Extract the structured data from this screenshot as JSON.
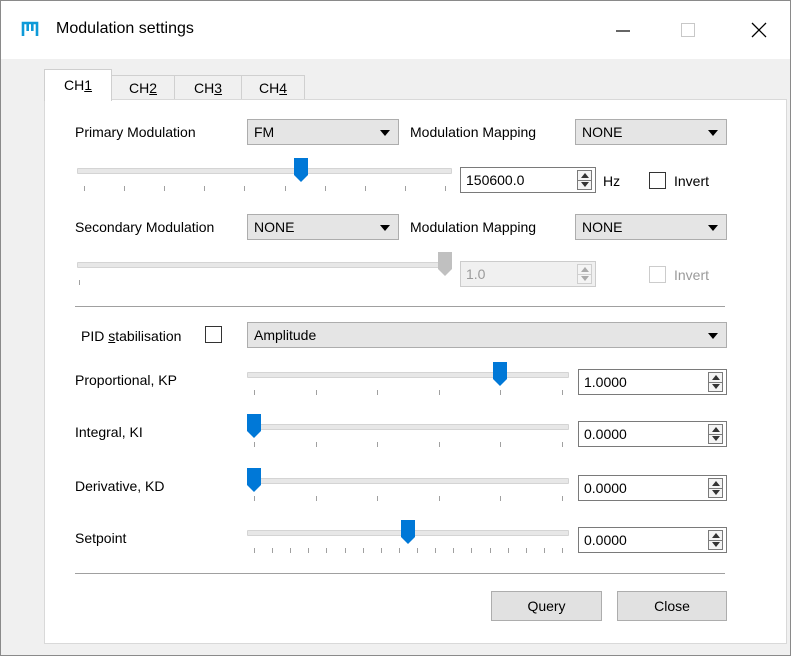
{
  "window": {
    "title": "Modulation settings",
    "icon": "app-logo-icon",
    "minimize": "minimize-icon",
    "maximize": "maximize-icon",
    "close": "close-icon"
  },
  "tabs": [
    {
      "pre": "CH",
      "key": "1",
      "active": true
    },
    {
      "pre": "CH",
      "key": "2",
      "active": false
    },
    {
      "pre": "CH",
      "key": "3",
      "active": false
    },
    {
      "pre": "CH",
      "key": "4",
      "active": false
    }
  ],
  "primary": {
    "label": "Primary Modulation",
    "modulation": "FM",
    "mapping_label": "Modulation Mapping",
    "mapping": "NONE",
    "slider_level": 0.6,
    "value": "150600.0",
    "unit": "Hz",
    "invert_label": "Invert",
    "invert_checked": false
  },
  "secondary": {
    "label": "Secondary Modulation",
    "modulation": "NONE",
    "mapping_label": "Modulation Mapping",
    "mapping": "NONE",
    "slider_level": 1.0,
    "value": "1.0",
    "invert_label": "Invert",
    "invert_checked": false
  },
  "pid": {
    "label_pre": "PID ",
    "label_key": "s",
    "label_post": "tabilisation",
    "checked": false,
    "source": "Amplitude",
    "rows": [
      {
        "name": "proportional",
        "label": "Proportional, KP",
        "value": "1.0000",
        "level": 0.8
      },
      {
        "name": "integral",
        "label": "Integral, KI",
        "value": "0.0000",
        "level": 0.0
      },
      {
        "name": "derivative",
        "label": "Derivative, KD",
        "value": "0.0000",
        "level": 0.0
      },
      {
        "name": "setpoint",
        "label": "Setpoint",
        "value": "0.0000",
        "level": 0.5
      }
    ]
  },
  "buttons": {
    "query": "Query",
    "close": "Close"
  },
  "colors": {
    "accent": "#0078d7",
    "thumb_disabled": "#c0c0c0"
  }
}
